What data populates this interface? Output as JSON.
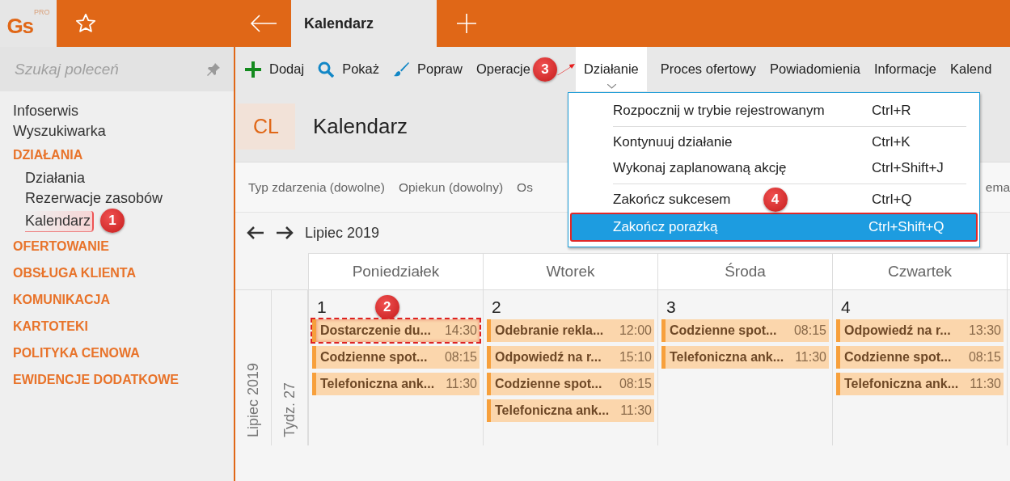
{
  "app": {
    "logo": "Gs",
    "logo_badge": "PRO"
  },
  "tabs": [
    {
      "label": "Kalendarz",
      "selected": true
    }
  ],
  "search": {
    "placeholder": "Szukaj poleceń"
  },
  "sidebar": {
    "items": [
      {
        "kind": "link",
        "label": "Infoserwis",
        "selected": false
      },
      {
        "kind": "link",
        "label": "Wyszukiwarka",
        "selected": false
      },
      {
        "kind": "section",
        "label": "DZIAŁANIA"
      },
      {
        "kind": "subitem",
        "label": "Działania",
        "selected": false
      },
      {
        "kind": "subitem",
        "label": "Rezerwacje zasobów",
        "selected": false
      },
      {
        "kind": "subitem",
        "label": "Kalendarz",
        "selected": true,
        "badge": "1"
      },
      {
        "kind": "section",
        "label": "OFERTOWANIE"
      },
      {
        "kind": "section",
        "label": "OBSŁUGA KLIENTA"
      },
      {
        "kind": "section",
        "label": "KOMUNIKACJA"
      },
      {
        "kind": "section",
        "label": "KARTOTEKI"
      },
      {
        "kind": "section",
        "label": "POLITYKA CENOWA"
      },
      {
        "kind": "section",
        "label": "EWIDENCJE DODATKOWE"
      }
    ]
  },
  "toolbar": [
    {
      "kind": "add",
      "label": "Dodaj",
      "selected": false
    },
    {
      "kind": "search",
      "label": "Pokaż",
      "selected": false
    },
    {
      "kind": "brush",
      "label": "Popraw",
      "selected": false
    },
    {
      "kind": "text",
      "label": "Operacje",
      "selected": false,
      "badge": "3"
    },
    {
      "kind": "menu",
      "label": "Działanie",
      "selected": true
    },
    {
      "kind": "text",
      "label": "Proces ofertowy",
      "selected": false
    },
    {
      "kind": "text",
      "label": "Powiadomienia",
      "selected": false
    },
    {
      "kind": "text",
      "label": "Informacje",
      "selected": false
    },
    {
      "kind": "text",
      "label": "Kalend",
      "selected": false
    }
  ],
  "header": {
    "badge": "CL",
    "title": "Kalendarz"
  },
  "filters": [
    "Typ zdarzenia (dowolne)",
    "Opiekun (dowolny)",
    "Os",
    "ema"
  ],
  "nav": {
    "period": "Lipiec 2019"
  },
  "calendar": {
    "month_label": "Lipiec 2019",
    "week_label": "Tydz. 27",
    "days": [
      {
        "name": "Poniedziałek",
        "date": "1",
        "events": [
          {
            "title": "Dostarczenie du...",
            "time": "14:30",
            "highlighted": true,
            "badge": "2"
          },
          {
            "title": "Codzienne spot...",
            "time": "08:15",
            "highlighted": false
          },
          {
            "title": "Telefoniczna ank...",
            "time": "11:30",
            "highlighted": false
          }
        ]
      },
      {
        "name": "Wtorek",
        "date": "2",
        "events": [
          {
            "title": "Odebranie rekla...",
            "time": "12:00",
            "highlighted": false
          },
          {
            "title": "Odpowiedź na r...",
            "time": "15:10",
            "highlighted": false
          },
          {
            "title": "Codzienne spot...",
            "time": "08:15",
            "highlighted": false
          },
          {
            "title": "Telefoniczna ank...",
            "time": "11:30",
            "highlighted": false
          }
        ]
      },
      {
        "name": "Środa",
        "date": "3",
        "events": [
          {
            "title": "Codzienne spot...",
            "time": "08:15",
            "highlighted": false
          },
          {
            "title": "Telefoniczna ank...",
            "time": "11:30",
            "highlighted": false
          }
        ]
      },
      {
        "name": "Czwartek",
        "date": "4",
        "events": [
          {
            "title": "Odpowiedź na r...",
            "time": "13:30",
            "highlighted": false
          },
          {
            "title": "Codzienne spot...",
            "time": "08:15",
            "highlighted": false
          },
          {
            "title": "Telefoniczna ank...",
            "time": "11:30",
            "highlighted": false
          }
        ]
      }
    ]
  },
  "menu": {
    "items": [
      {
        "label": "Rozpocznij w trybie rejestrowanym",
        "shortcut": "Ctrl+R",
        "selected": false,
        "separator_after": true
      },
      {
        "label": "Kontynuuj działanie",
        "shortcut": "Ctrl+K",
        "selected": false,
        "separator_after": false
      },
      {
        "label": "Wykonaj zaplanowaną akcję",
        "shortcut": "Ctrl+Shift+J",
        "selected": false,
        "separator_after": true
      },
      {
        "label": "Zakończ sukcesem",
        "shortcut": "Ctrl+Q",
        "selected": false,
        "separator_after": false,
        "badge": "4"
      },
      {
        "label": "Zakończ porażką",
        "shortcut": "Ctrl+Shift+Q",
        "selected": true,
        "separator_after": false
      }
    ]
  }
}
